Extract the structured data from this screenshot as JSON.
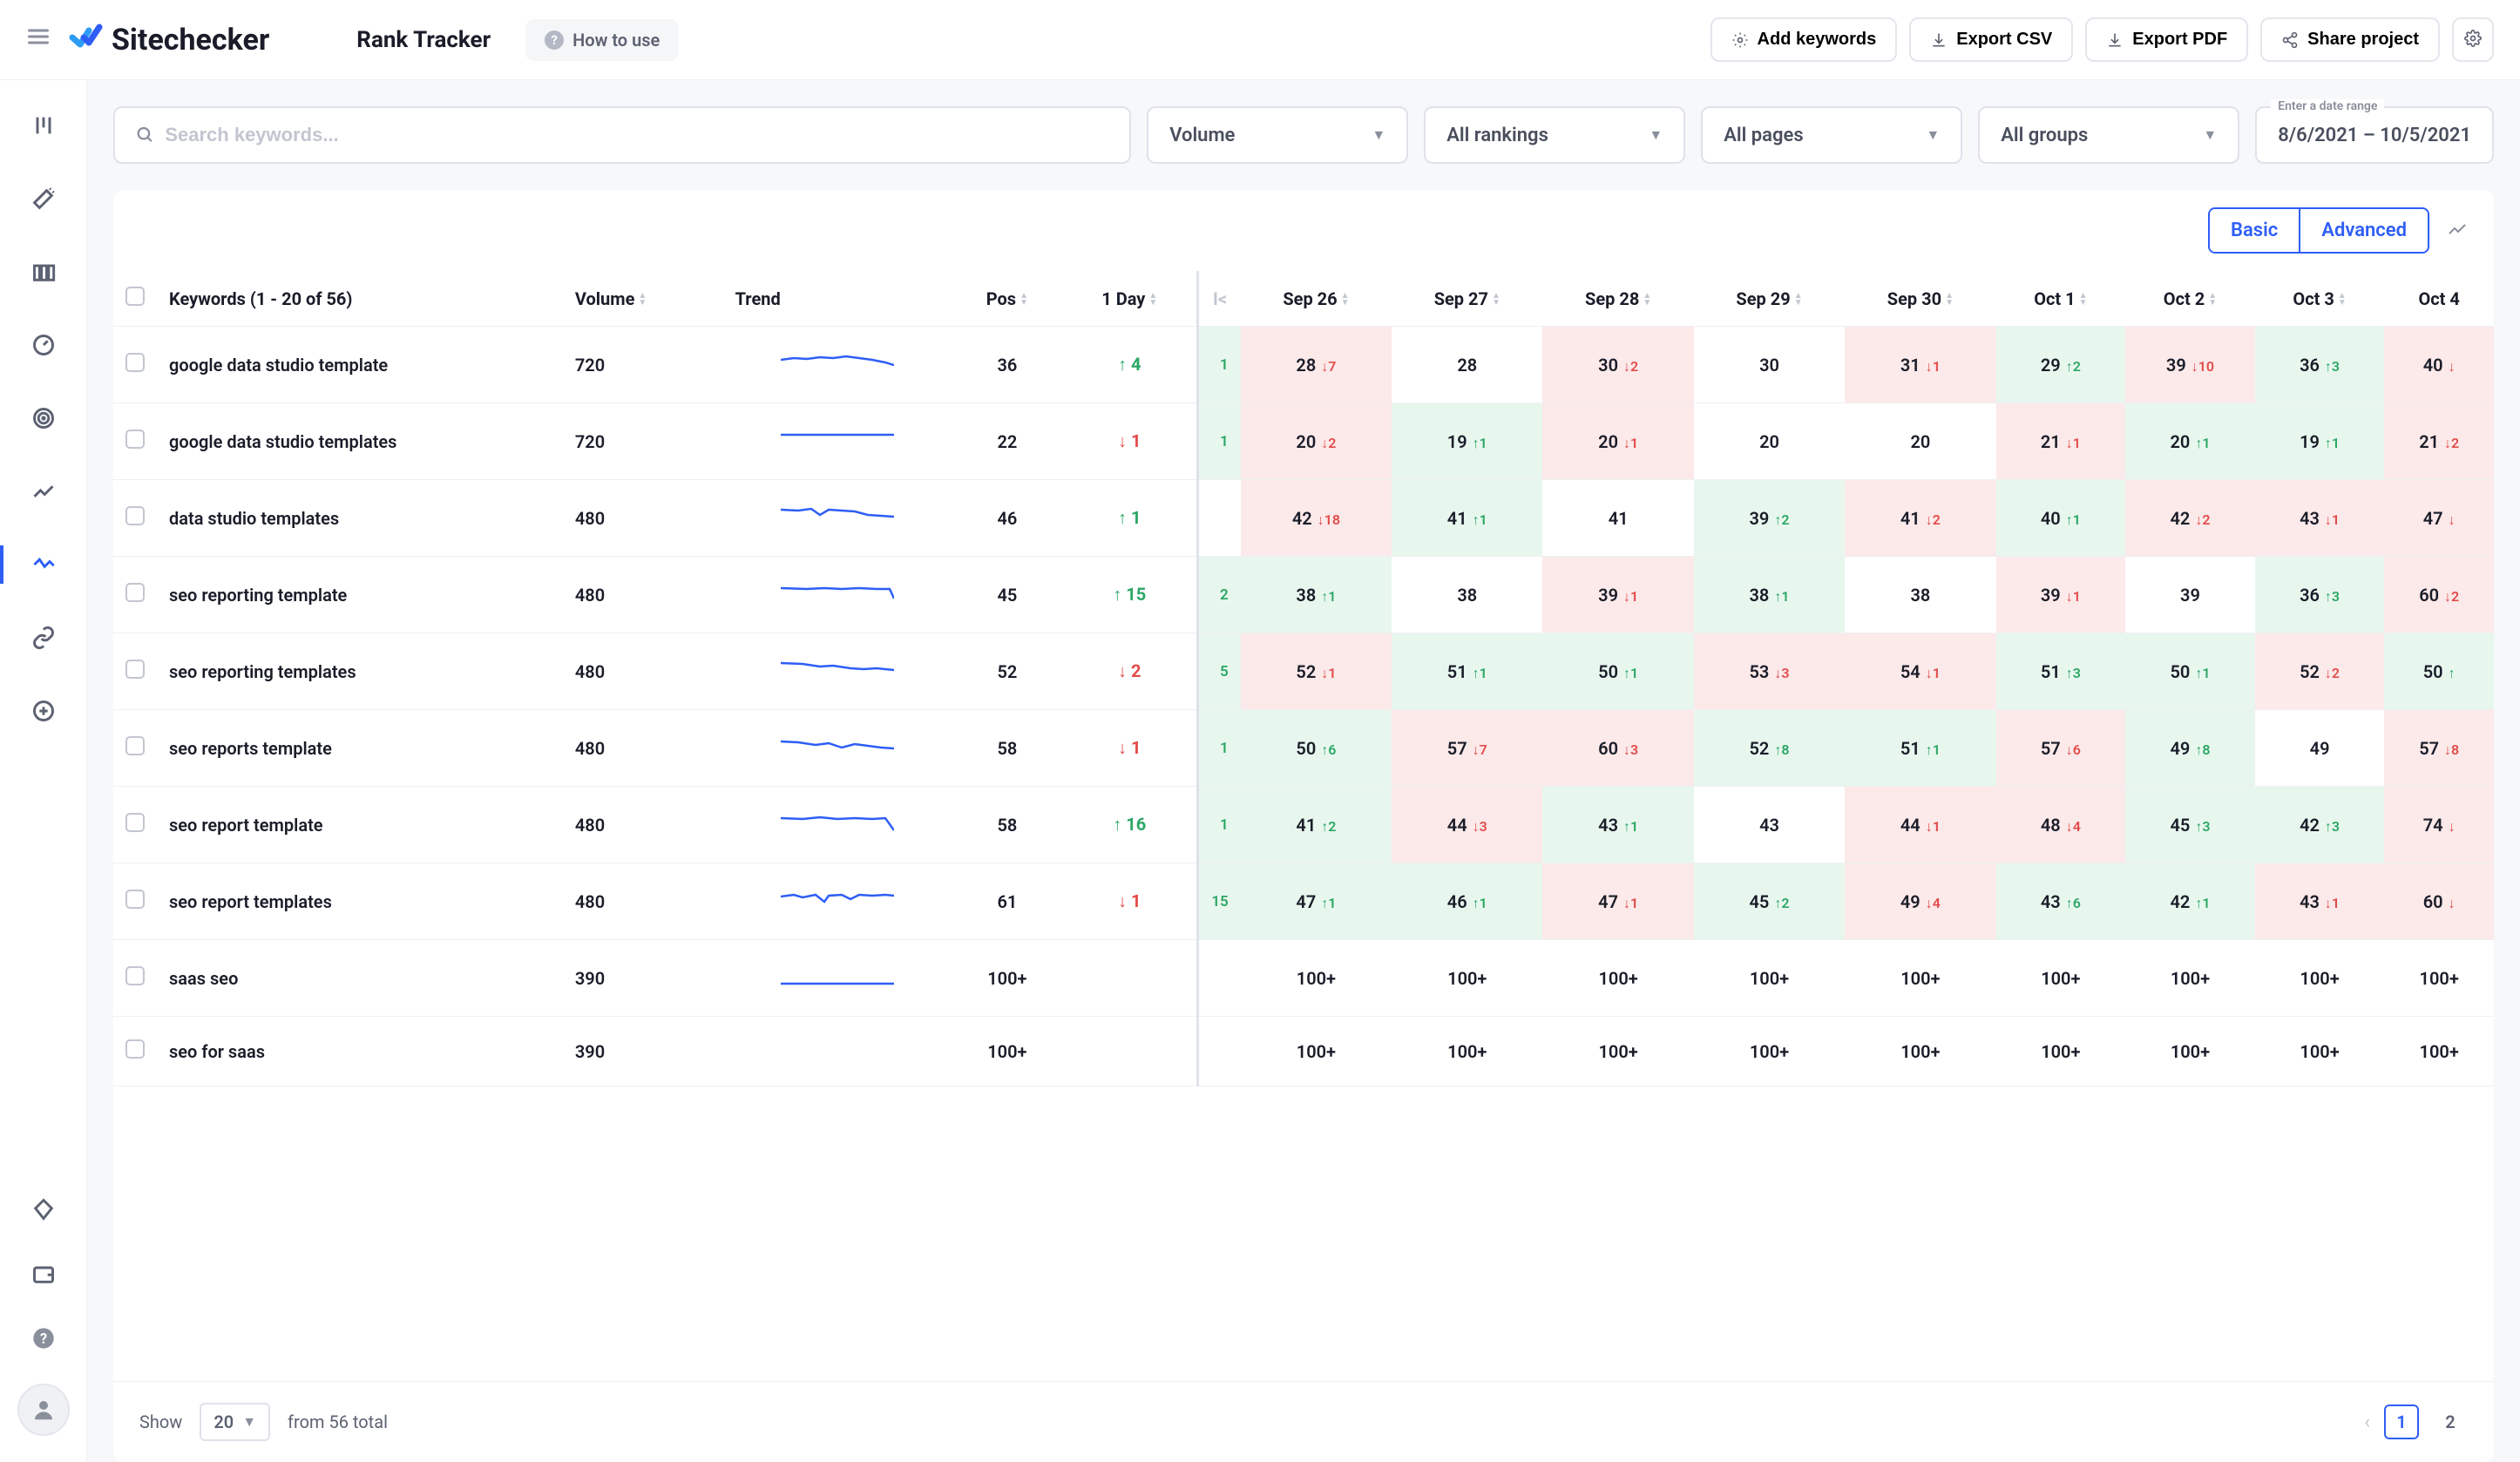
{
  "app": {
    "name": "Sitechecker"
  },
  "header": {
    "page_title": "Rank Tracker",
    "how_to_use": "How to use",
    "actions": {
      "add_keywords": "Add keywords",
      "export_csv": "Export CSV",
      "export_pdf": "Export PDF",
      "share_project": "Share project"
    }
  },
  "filters": {
    "search_placeholder": "Search keywords...",
    "volume": "Volume",
    "rankings": "All rankings",
    "pages": "All pages",
    "groups": "All groups",
    "date_label": "Enter a date range",
    "date_value": "8/6/2021 – 10/5/2021"
  },
  "view_toggle": {
    "basic": "Basic",
    "advanced": "Advanced"
  },
  "columns": {
    "keywords": "Keywords (1 - 20 of 56)",
    "volume": "Volume",
    "trend": "Trend",
    "pos": "Pos",
    "day1": "1 Day",
    "dates": [
      "Sep 26",
      "Sep 27",
      "Sep 28",
      "Sep 29",
      "Sep 30",
      "Oct 1",
      "Oct 2",
      "Oct 3",
      "Oct 4"
    ]
  },
  "rows": [
    {
      "keyword": "google data studio template",
      "volume": "720",
      "pos": "36",
      "day1": {
        "dir": "up",
        "val": "4"
      },
      "partial": {
        "val": "1",
        "bg": "up"
      },
      "dates": [
        {
          "val": "28",
          "delta": "7",
          "dir": "down"
        },
        {
          "val": "28"
        },
        {
          "val": "30",
          "delta": "2",
          "dir": "down"
        },
        {
          "val": "30"
        },
        {
          "val": "31",
          "delta": "1",
          "dir": "down"
        },
        {
          "val": "29",
          "delta": "2",
          "dir": "up"
        },
        {
          "val": "39",
          "delta": "10",
          "dir": "down"
        },
        {
          "val": "36",
          "delta": "3",
          "dir": "up"
        },
        {
          "val": "40",
          "delta": "",
          "dir": "down"
        }
      ]
    },
    {
      "keyword": "google data studio templates",
      "volume": "720",
      "pos": "22",
      "day1": {
        "dir": "down",
        "val": "1"
      },
      "partial": {
        "val": "1",
        "bg": "up"
      },
      "dates": [
        {
          "val": "20",
          "delta": "2",
          "dir": "down"
        },
        {
          "val": "19",
          "delta": "1",
          "dir": "up"
        },
        {
          "val": "20",
          "delta": "1",
          "dir": "down"
        },
        {
          "val": "20"
        },
        {
          "val": "20"
        },
        {
          "val": "21",
          "delta": "1",
          "dir": "down"
        },
        {
          "val": "20",
          "delta": "1",
          "dir": "up"
        },
        {
          "val": "19",
          "delta": "1",
          "dir": "up"
        },
        {
          "val": "21",
          "delta": "2",
          "dir": "down"
        }
      ]
    },
    {
      "keyword": "data studio templates",
      "volume": "480",
      "pos": "46",
      "day1": {
        "dir": "up",
        "val": "1"
      },
      "partial": {
        "val": "",
        "bg": ""
      },
      "dates": [
        {
          "val": "42",
          "delta": "18",
          "dir": "down"
        },
        {
          "val": "41",
          "delta": "1",
          "dir": "up"
        },
        {
          "val": "41"
        },
        {
          "val": "39",
          "delta": "2",
          "dir": "up"
        },
        {
          "val": "41",
          "delta": "2",
          "dir": "down"
        },
        {
          "val": "40",
          "delta": "1",
          "dir": "up"
        },
        {
          "val": "42",
          "delta": "2",
          "dir": "down"
        },
        {
          "val": "43",
          "delta": "1",
          "dir": "down"
        },
        {
          "val": "47",
          "delta": "",
          "dir": "down"
        }
      ]
    },
    {
      "keyword": "seo reporting template",
      "volume": "480",
      "pos": "45",
      "day1": {
        "dir": "up",
        "val": "15"
      },
      "partial": {
        "val": "2",
        "bg": "up"
      },
      "dates": [
        {
          "val": "38",
          "delta": "1",
          "dir": "up"
        },
        {
          "val": "38"
        },
        {
          "val": "39",
          "delta": "1",
          "dir": "down"
        },
        {
          "val": "38",
          "delta": "1",
          "dir": "up"
        },
        {
          "val": "38"
        },
        {
          "val": "39",
          "delta": "1",
          "dir": "down"
        },
        {
          "val": "39"
        },
        {
          "val": "36",
          "delta": "3",
          "dir": "up"
        },
        {
          "val": "60",
          "delta": "2",
          "dir": "down"
        }
      ]
    },
    {
      "keyword": "seo reporting templates",
      "volume": "480",
      "pos": "52",
      "day1": {
        "dir": "down",
        "val": "2"
      },
      "partial": {
        "val": "5",
        "bg": "up"
      },
      "dates": [
        {
          "val": "52",
          "delta": "1",
          "dir": "down"
        },
        {
          "val": "51",
          "delta": "1",
          "dir": "up"
        },
        {
          "val": "50",
          "delta": "1",
          "dir": "up"
        },
        {
          "val": "53",
          "delta": "3",
          "dir": "down"
        },
        {
          "val": "54",
          "delta": "1",
          "dir": "down"
        },
        {
          "val": "51",
          "delta": "3",
          "dir": "up"
        },
        {
          "val": "50",
          "delta": "1",
          "dir": "up"
        },
        {
          "val": "52",
          "delta": "2",
          "dir": "down"
        },
        {
          "val": "50",
          "delta": "",
          "dir": "up"
        }
      ]
    },
    {
      "keyword": "seo reports template",
      "volume": "480",
      "pos": "58",
      "day1": {
        "dir": "down",
        "val": "1"
      },
      "partial": {
        "val": "1",
        "bg": "up"
      },
      "dates": [
        {
          "val": "50",
          "delta": "6",
          "dir": "up"
        },
        {
          "val": "57",
          "delta": "7",
          "dir": "down"
        },
        {
          "val": "60",
          "delta": "3",
          "dir": "down"
        },
        {
          "val": "52",
          "delta": "8",
          "dir": "up"
        },
        {
          "val": "51",
          "delta": "1",
          "dir": "up"
        },
        {
          "val": "57",
          "delta": "6",
          "dir": "down"
        },
        {
          "val": "49",
          "delta": "8",
          "dir": "up"
        },
        {
          "val": "49"
        },
        {
          "val": "57",
          "delta": "8",
          "dir": "down"
        }
      ]
    },
    {
      "keyword": "seo report template",
      "volume": "480",
      "pos": "58",
      "day1": {
        "dir": "up",
        "val": "16"
      },
      "partial": {
        "val": "1",
        "bg": "up"
      },
      "dates": [
        {
          "val": "41",
          "delta": "2",
          "dir": "up"
        },
        {
          "val": "44",
          "delta": "3",
          "dir": "down"
        },
        {
          "val": "43",
          "delta": "1",
          "dir": "up"
        },
        {
          "val": "43"
        },
        {
          "val": "44",
          "delta": "1",
          "dir": "down"
        },
        {
          "val": "48",
          "delta": "4",
          "dir": "down"
        },
        {
          "val": "45",
          "delta": "3",
          "dir": "up"
        },
        {
          "val": "42",
          "delta": "3",
          "dir": "up"
        },
        {
          "val": "74",
          "delta": "",
          "dir": "down"
        }
      ]
    },
    {
      "keyword": "seo report templates",
      "volume": "480",
      "pos": "61",
      "day1": {
        "dir": "down",
        "val": "1"
      },
      "partial": {
        "val": "15",
        "bg": "up"
      },
      "dates": [
        {
          "val": "47",
          "delta": "1",
          "dir": "up"
        },
        {
          "val": "46",
          "delta": "1",
          "dir": "up"
        },
        {
          "val": "47",
          "delta": "1",
          "dir": "down"
        },
        {
          "val": "45",
          "delta": "2",
          "dir": "up"
        },
        {
          "val": "49",
          "delta": "4",
          "dir": "down"
        },
        {
          "val": "43",
          "delta": "6",
          "dir": "up"
        },
        {
          "val": "42",
          "delta": "1",
          "dir": "up"
        },
        {
          "val": "43",
          "delta": "1",
          "dir": "down"
        },
        {
          "val": "60",
          "delta": "",
          "dir": "down"
        }
      ]
    },
    {
      "keyword": "saas seo",
      "volume": "390",
      "pos": "100+",
      "day1": null,
      "partial": {
        "val": "",
        "bg": ""
      },
      "dates": [
        {
          "val": "100+"
        },
        {
          "val": "100+"
        },
        {
          "val": "100+"
        },
        {
          "val": "100+"
        },
        {
          "val": "100+"
        },
        {
          "val": "100+"
        },
        {
          "val": "100+"
        },
        {
          "val": "100+"
        },
        {
          "val": "100+"
        }
      ]
    },
    {
      "keyword": "seo for saas",
      "volume": "390",
      "pos": "100+",
      "day1": null,
      "partial": {
        "val": "",
        "bg": ""
      },
      "dates": [
        {
          "val": "100+"
        },
        {
          "val": "100+"
        },
        {
          "val": "100+"
        },
        {
          "val": "100+"
        },
        {
          "val": "100+"
        },
        {
          "val": "100+"
        },
        {
          "val": "100+"
        },
        {
          "val": "100+"
        },
        {
          "val": "100+"
        }
      ]
    }
  ],
  "footer": {
    "show": "Show",
    "per_page": "20",
    "total": "from 56 total",
    "page_current": "1",
    "page_next": "2"
  }
}
